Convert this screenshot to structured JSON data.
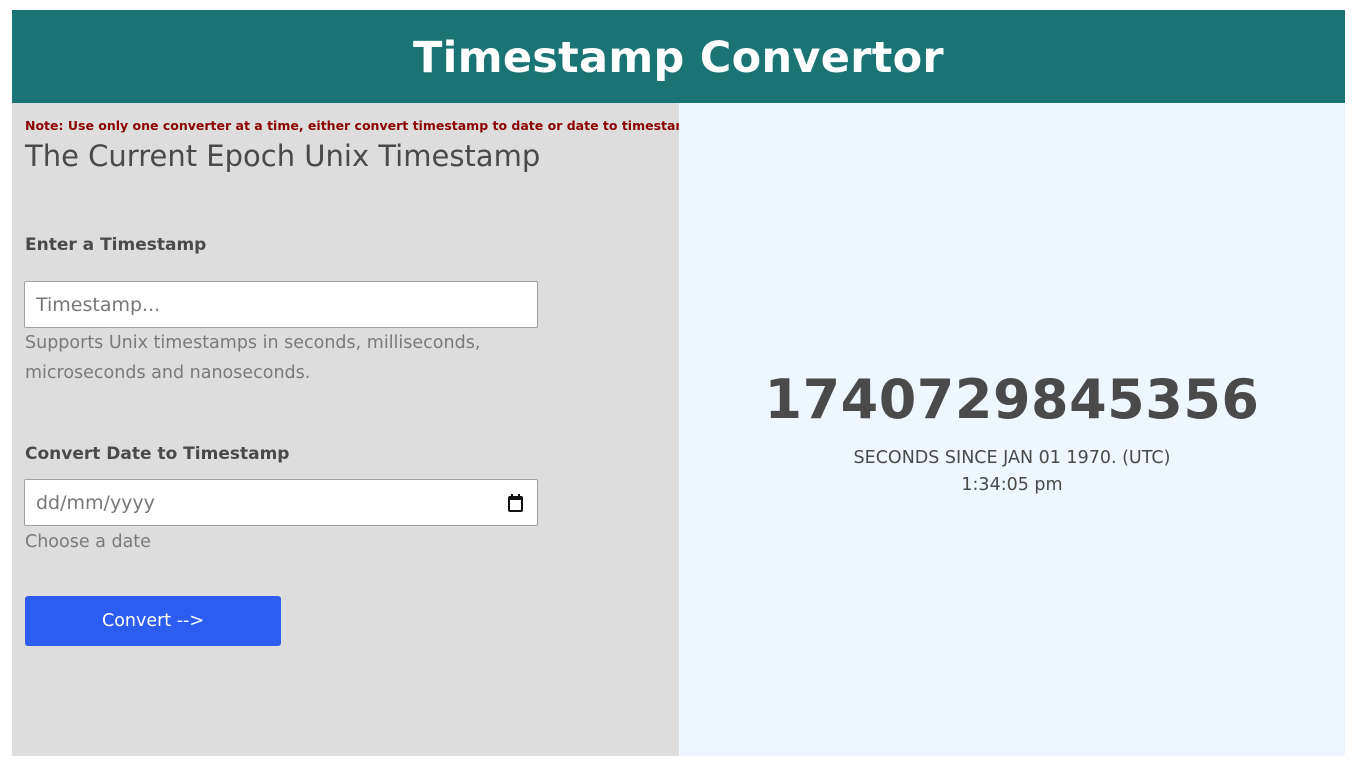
{
  "header": {
    "title": "Timestamp Convertor",
    "bg_color": "#1b7474"
  },
  "left_panel": {
    "note": "Note: Use only one converter at a time, either convert timestamp to date or date to timestamp.",
    "title": "The Current Epoch Unix Timestamp",
    "timestamp_section": {
      "label": "Enter a Timestamp",
      "placeholder": "Timestamp...",
      "value": "",
      "help": "Supports Unix timestamps in seconds, milliseconds, microseconds and nanoseconds."
    },
    "date_section": {
      "label": "Convert Date to Timestamp",
      "placeholder": "dd/mm/yyyy",
      "icon": "calendar-icon",
      "help": "Choose a date"
    },
    "convert_button": {
      "label": "Convert -->",
      "color": "#2d5cf0"
    }
  },
  "right_panel": {
    "epoch_value": "1740729845356",
    "caption": "SECONDS SINCE JAN 01 1970. (UTC)",
    "time": "1:34:05 pm"
  },
  "colors": {
    "note": "#8b0000",
    "left_bg": "#dddddd",
    "right_bg": "#eef6ff"
  }
}
